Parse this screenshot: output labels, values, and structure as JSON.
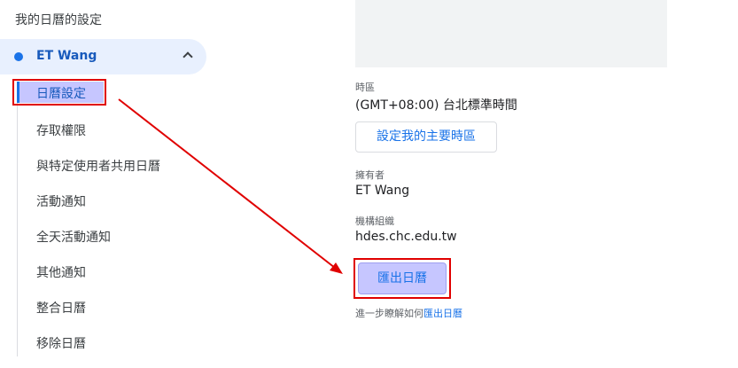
{
  "sidebar": {
    "section_title": "我的日曆的設定",
    "calendar_name": "ET Wang",
    "items": [
      {
        "label": "日曆設定"
      },
      {
        "label": "存取權限"
      },
      {
        "label": "與特定使用者共用日曆"
      },
      {
        "label": "活動通知"
      },
      {
        "label": "全天活動通知"
      },
      {
        "label": "其他通知"
      },
      {
        "label": "整合日曆"
      },
      {
        "label": "移除日曆"
      }
    ]
  },
  "main": {
    "timezone": {
      "label": "時區",
      "value": "(GMT+08:00) 台北標準時間",
      "button_label": "設定我的主要時區"
    },
    "owner": {
      "label": "擁有者",
      "value": "ET Wang"
    },
    "organization": {
      "label": "機構組織",
      "value": "hdes.chc.edu.tw"
    },
    "export_button_label": "匯出日曆",
    "help": {
      "prefix": "進一步瞭解如何",
      "link": "匯出日曆"
    }
  },
  "colors": {
    "highlight_box": "#e00000",
    "highlight_fill": "#c6c6ff",
    "accent": "#1a73e8",
    "arrow": "#e00000"
  }
}
